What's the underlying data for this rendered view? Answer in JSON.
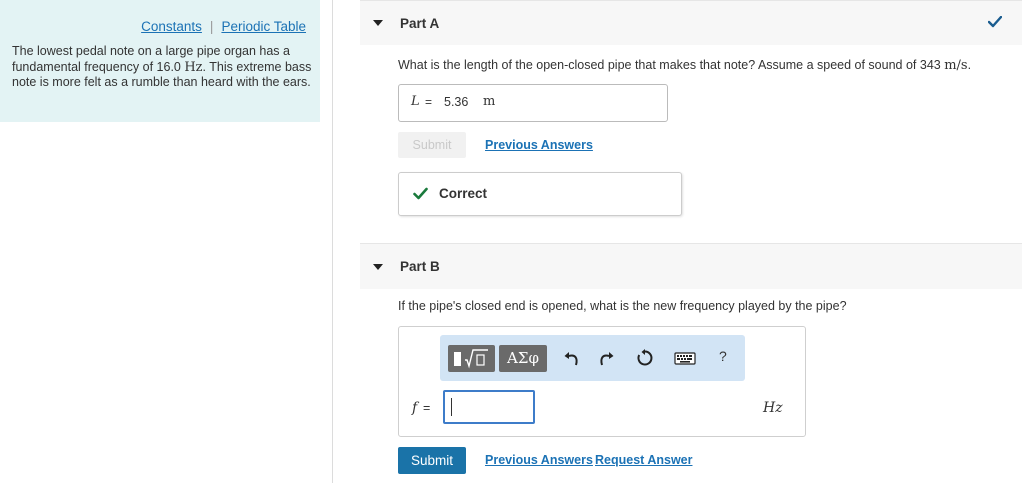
{
  "left_panel": {
    "links": {
      "constants": "Constants",
      "separator": "|",
      "periodic_table": "Periodic Table"
    },
    "problem": {
      "text_before": "The lowest pedal note on a large pipe organ has a fundamental frequency of 16.0 ",
      "unit": "Hz",
      "text_after": ". This extreme bass note is more felt as a rumble than heard with the ears."
    }
  },
  "part_a": {
    "title": "Part A",
    "question_before": "What is the length of the open-closed pipe that makes that note? Assume a speed of sound of 343 ",
    "question_unit": "m/s",
    "question_after": ".",
    "answer": {
      "variable": "L",
      "equals": "=",
      "value": "5.36",
      "unit": "m"
    },
    "submit_label": "Submit",
    "previous_answers": "Previous Answers",
    "feedback": "Correct"
  },
  "part_b": {
    "title": "Part B",
    "question": "If the pipe's closed end is opened, what is the new frequency played by the pipe?",
    "toolbar": {
      "greek_label": "ΑΣφ",
      "help_label": "?"
    },
    "answer": {
      "variable": "f",
      "equals": "=",
      "value": "",
      "unit": "Hz"
    },
    "submit_label": "Submit",
    "previous_answers": "Previous Answers",
    "request_answer": "Request Answer"
  },
  "colors": {
    "accent": "#1a73a8",
    "link": "#1b72b5",
    "correct": "#1a7a3c",
    "panel_bg": "#e3f3f4",
    "toolbar_bg": "#d2e4f5"
  }
}
